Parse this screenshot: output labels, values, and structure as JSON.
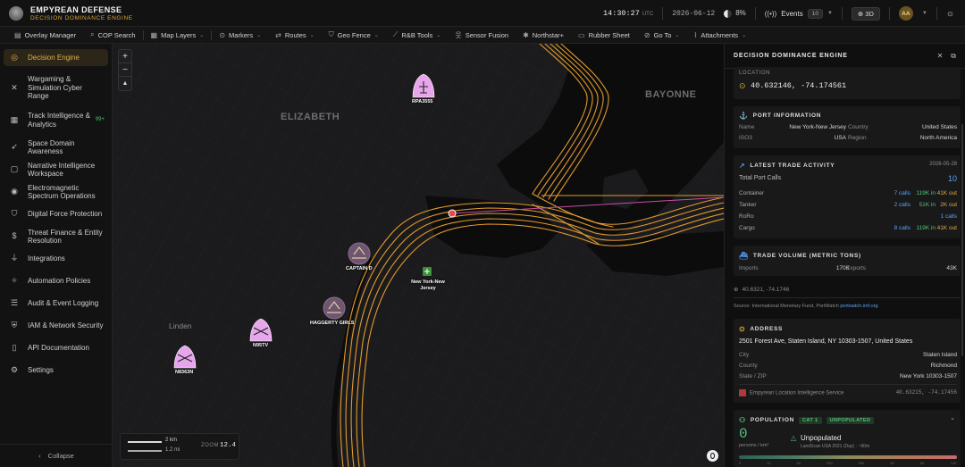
{
  "app": {
    "title": "EMPYREAN DEFENSE",
    "subtitle": "DECISION DOMINANCE ENGINE"
  },
  "status": {
    "time": "14:30:27",
    "tz": "UTC",
    "date": "2026-06-12",
    "moon": "8%",
    "events_label": "Events",
    "events_count": "10",
    "view_mode": "3D",
    "user_initials": "AA"
  },
  "toolbar": [
    {
      "label": "Overlay Manager",
      "icon": "layers-stack-icon",
      "chev": false
    },
    {
      "label": "COP Search",
      "icon": "search-icon",
      "chev": false
    },
    {
      "label": "Map Layers",
      "icon": "map-icon",
      "chev": true
    },
    {
      "label": "Markers",
      "icon": "pin-icon",
      "chev": true
    },
    {
      "label": "Routes",
      "icon": "route-icon",
      "chev": true
    },
    {
      "label": "Geo Fence",
      "icon": "shield-icon",
      "chev": true
    },
    {
      "label": "R&B Tools",
      "icon": "ruler-icon",
      "chev": true
    },
    {
      "label": "Sensor Fusion",
      "icon": "person-icon",
      "chev": false
    },
    {
      "label": "Northstar+",
      "icon": "sparkle-icon",
      "chev": false
    },
    {
      "label": "Rubber Sheet",
      "icon": "sheet-icon",
      "chev": false
    },
    {
      "label": "Go To",
      "icon": "compass-icon",
      "chev": true
    },
    {
      "label": "Attachments",
      "icon": "paperclip-icon",
      "chev": true
    }
  ],
  "sidebar": {
    "items": [
      {
        "label": "Decision Engine",
        "icon": "target-icon",
        "active": true
      },
      {
        "label": "Wargaming & Simulation Cyber Range",
        "icon": "crossed-swords-icon"
      },
      {
        "label": "Track Intelligence & Analytics",
        "icon": "grid-icon",
        "badge": "99+"
      },
      {
        "label": "Space Domain Awareness",
        "icon": "rocket-icon"
      },
      {
        "label": "Narrative Intelligence Workspace",
        "icon": "chat-icon"
      },
      {
        "label": "Electromagnetic Spectrum Operations",
        "icon": "radio-icon"
      },
      {
        "label": "Digital Force Protection",
        "icon": "shield-icon"
      },
      {
        "label": "Threat Finance & Entity Resolution",
        "icon": "dollar-icon"
      },
      {
        "label": "Integrations",
        "icon": "plug-icon"
      },
      {
        "label": "Automation Policies",
        "icon": "wand-icon"
      },
      {
        "label": "Audit & Event Logging",
        "icon": "log-icon"
      },
      {
        "label": "IAM & Network Security",
        "icon": "shield-check-icon"
      },
      {
        "label": "API Documentation",
        "icon": "book-icon"
      },
      {
        "label": "Settings",
        "icon": "gear-icon"
      }
    ],
    "collapse": "Collapse"
  },
  "map": {
    "cities": [
      "ELIZABETH",
      "BAYONNE"
    ],
    "places": [
      "Linden"
    ],
    "port_label": "New York-New Jersey",
    "markers": [
      "RPA3555",
      "CAPTAIN D",
      "HAGGERTY GIRLS",
      "N95TV",
      "N8363N"
    ],
    "scale_km": "2 km",
    "scale_mi": "1.2 mi",
    "zoom_label": "ZOOM",
    "zoom_value": "12.4"
  },
  "panel": {
    "title": "DECISION DOMINANCE ENGINE",
    "location_label": "LOCATION",
    "coords": "40.632146, -74.174561",
    "port_info": {
      "title": "PORT INFORMATION",
      "name_label": "Name",
      "name": "New York-New Jersey",
      "country_label": "Country",
      "country": "United States",
      "iso_label": "ISO3",
      "iso": "USA",
      "region_label": "Region",
      "region": "North America"
    },
    "trade": {
      "title": "LATEST TRADE ACTIVITY",
      "date": "2026-05-28",
      "total_label": "Total Port Calls",
      "total": "10",
      "rows": [
        {
          "type": "Container",
          "calls": "7 calls",
          "import": "119K in",
          "export": "41K out"
        },
        {
          "type": "Tanker",
          "calls": "2 calls",
          "import": "51K in",
          "export": "2K out"
        },
        {
          "type": "RoRo",
          "calls": "1 calls",
          "import": "",
          "export": ""
        },
        {
          "type": "Cargo",
          "calls": "8 calls",
          "import": "119K in",
          "export": "41K out"
        }
      ]
    },
    "volume": {
      "title": "TRADE VOLUME (METRIC TONS)",
      "imports_label": "Imports",
      "imports": "170K",
      "exports_label": "Exports",
      "exports": "43K"
    },
    "mini_coords": "40.6321, -74.1746",
    "source_text": "Source: International Monetary Fund, PortWatch",
    "source_link": "portwatch.imf.org",
    "address": {
      "title": "ADDRESS",
      "line": "2501 Forest Ave, Staten Island, NY 10303-1507, United States",
      "city_label": "City",
      "city": "Staten Island",
      "county_label": "County",
      "county": "Richmond",
      "state_label": "State / ZIP",
      "state": "New York 10303-1507",
      "service": "Empyrean Location Intelligence Service",
      "service_coords": "40.63215, -74.17456"
    },
    "population": {
      "title": "POPULATION",
      "tag1": "CAT 1",
      "tag2": "UNPOPULATED",
      "value": "0",
      "unit": "persons / km²",
      "status": "Unpopulated",
      "status_sub": "LandScan USA 2021 (Day) · ~90m",
      "scale_ticks": [
        "0",
        "10",
        "50",
        "100",
        "500",
        "1K",
        "5K",
        "10K"
      ]
    }
  },
  "colors": {
    "accent": "#e5b04d",
    "route": "#e29a2c",
    "marker": "#e7a6ec",
    "link": "#5aa2f0",
    "ok": "#53c27a"
  }
}
